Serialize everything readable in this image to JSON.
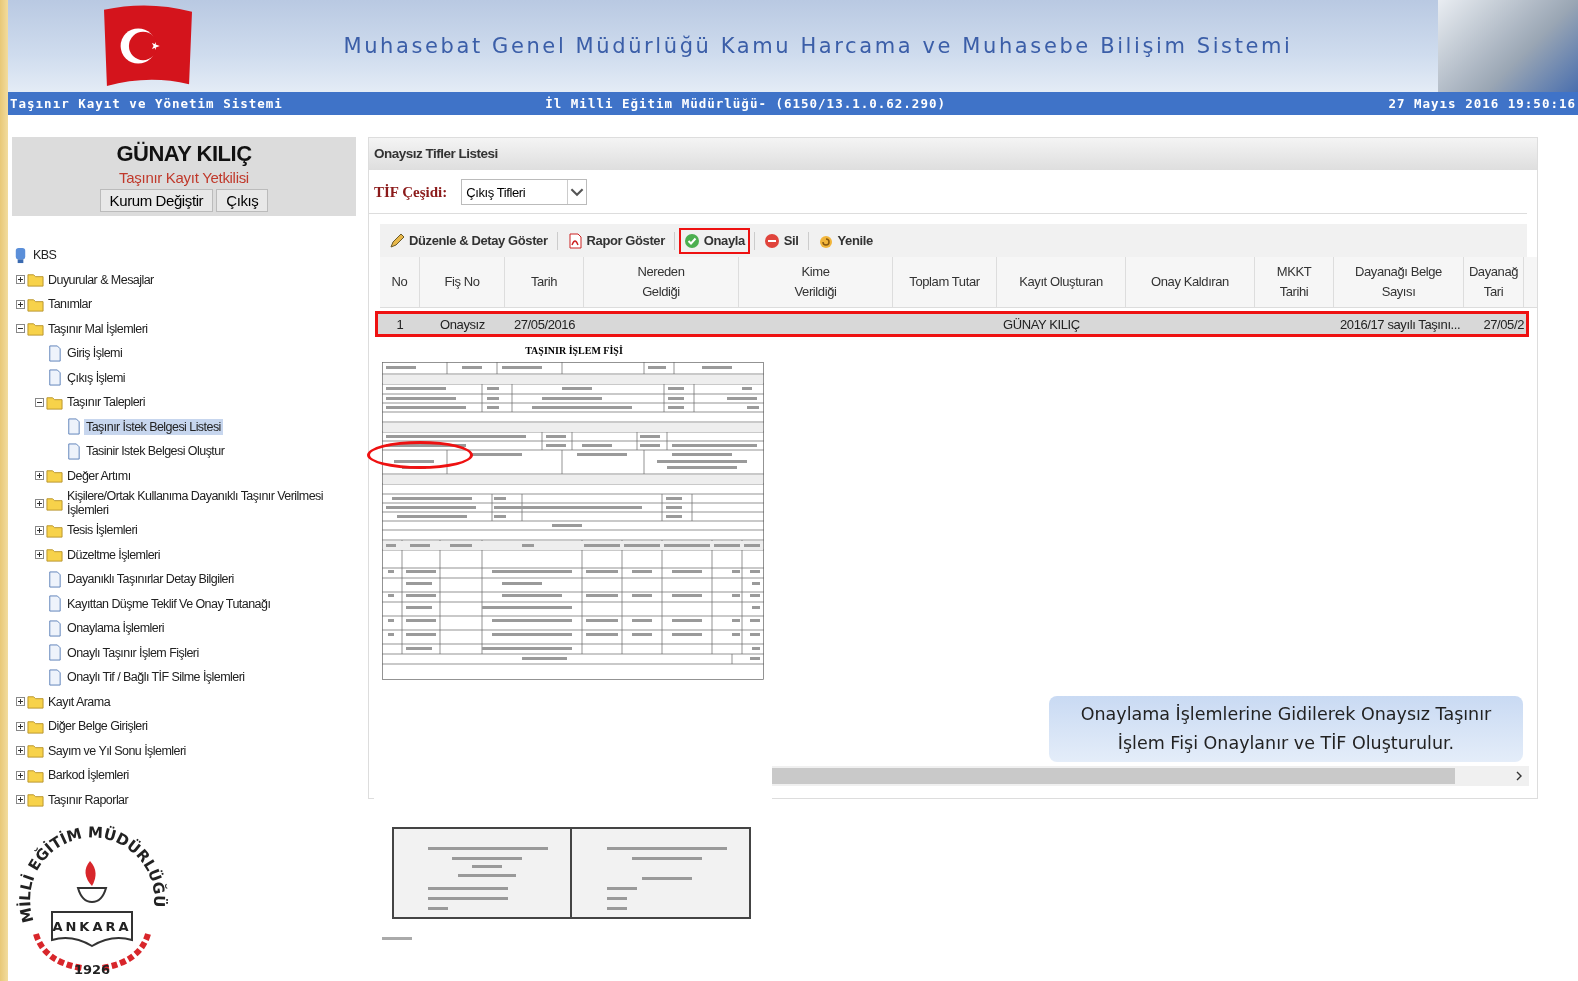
{
  "header": {
    "title": "Muhasebat Genel Müdürlüğü Kamu Harcama ve Muhasebe Bilişim Sistemi",
    "system": "Taşınır Kayıt ve Yönetim Sistemi",
    "unit": "İl Milli Eğitim Müdürlüğü- (6150/13.1.0.62.290)",
    "datetime": "27 Mayıs 2016 19:50:16"
  },
  "user": {
    "name": "GÜNAY KILIÇ",
    "role": "Taşınır Kayıt Yetkilisi",
    "buttons": [
      "Kurum Değiştir",
      "Çıkış"
    ]
  },
  "tree": {
    "root": "KBS",
    "items": [
      {
        "label": "Duyurular & Mesajlar",
        "kind": "folder",
        "expanded": false,
        "selected": false
      },
      {
        "label": "Tanımlar",
        "kind": "folder",
        "expanded": false,
        "selected": false
      },
      {
        "label": "Taşınır Mal İşlemleri",
        "kind": "folder",
        "expanded": true,
        "selected": false,
        "children": [
          {
            "label": "Giriş İşlemi",
            "kind": "page",
            "selected": false
          },
          {
            "label": "Çıkış İşlemi",
            "kind": "page",
            "selected": false
          },
          {
            "label": "Taşınır Talepleri",
            "kind": "folder",
            "expanded": true,
            "selected": false,
            "children": [
              {
                "label": "Taşınır İstek Belgesi Listesi",
                "kind": "page",
                "selected": true
              },
              {
                "label": "Tasinir Istek Belgesi Oluştur",
                "kind": "page",
                "selected": false
              }
            ]
          },
          {
            "label": "Değer Artımı",
            "kind": "folder",
            "expanded": false,
            "selected": false
          },
          {
            "label": "Kişilere/Ortak Kullanıma Dayanıklı Taşınır Verilmesi İşlemleri",
            "kind": "folder",
            "expanded": false,
            "selected": false
          },
          {
            "label": "Tesis İşlemleri",
            "kind": "folder",
            "expanded": false,
            "selected": false
          },
          {
            "label": "Düzeltme İşlemleri",
            "kind": "folder",
            "expanded": false,
            "selected": false
          },
          {
            "label": "Dayanıklı Taşınırlar Detay Bilgileri",
            "kind": "page",
            "selected": false
          },
          {
            "label": "Kayıttan Düşme Teklif Ve Onay Tutanağı",
            "kind": "page",
            "selected": false
          },
          {
            "label": "Onaylama İşlemleri",
            "kind": "page",
            "selected": false
          },
          {
            "label": "Onaylı Taşınır İşlem Fişleri",
            "kind": "page",
            "selected": false
          },
          {
            "label": "Onaylı Tif / Bağlı TİF Silme İşlemleri",
            "kind": "page",
            "selected": false
          }
        ]
      },
      {
        "label": "Kayıt Arama",
        "kind": "folder",
        "expanded": false,
        "selected": false
      },
      {
        "label": "Diğer Belge Girişleri",
        "kind": "folder",
        "expanded": false,
        "selected": false
      },
      {
        "label": "Sayım ve Yıl Sonu İşlemleri",
        "kind": "folder",
        "expanded": false,
        "selected": false
      },
      {
        "label": "Barkod İşlemleri",
        "kind": "folder",
        "expanded": false,
        "selected": false
      },
      {
        "label": "Taşınır Raporlar",
        "kind": "folder",
        "expanded": false,
        "selected": false
      }
    ]
  },
  "logo": {
    "arc": "MİLLİ EĞİTİM MÜDÜRLÜĞÜ",
    "city": "ANKARA",
    "year": "1926"
  },
  "panel": {
    "title": "Onaysız Tifler Listesi",
    "filter_label": "TİF Çeşidi:",
    "filter_value": "Çıkış Tifleri"
  },
  "toolbar": [
    {
      "label": "Düzenle & Detay Göster",
      "kind": "edit",
      "highlighted": false
    },
    {
      "label": "Rapor Göster",
      "kind": "pdf",
      "highlighted": false
    },
    {
      "label": "Onayla",
      "kind": "approve",
      "highlighted": true
    },
    {
      "label": "Sil",
      "kind": "delete",
      "highlighted": false
    },
    {
      "label": "Yenile",
      "kind": "refresh",
      "highlighted": false
    }
  ],
  "table": {
    "columns": [
      "No",
      "Fiş No",
      "Tarih",
      "Nereden\nGeldiği",
      "Kime\nVerildiği",
      "Toplam Tutar",
      "Kayıt Oluşturan",
      "Onay Kaldıran",
      "MKKT\nTarihi",
      "Dayanağı Belge\nSayısı",
      "Dayanağ\nTari"
    ],
    "rows": [
      {
        "selected": true,
        "highlighted": true,
        "cells": [
          "1",
          "Onaysız",
          "27/05/2016",
          null,
          null,
          null,
          "GÜNAY KILIÇ",
          null,
          null,
          "2016/17 sayılı Taşını...",
          "27/05/2"
        ]
      }
    ]
  },
  "document": {
    "title": "TAŞINIR İŞLEM FİŞİ"
  },
  "callout": "Onaylama İşlemlerine Gidilerek Onaysız Taşınır İşlem Fişi Onaylanır ve TİF Oluşturulur."
}
